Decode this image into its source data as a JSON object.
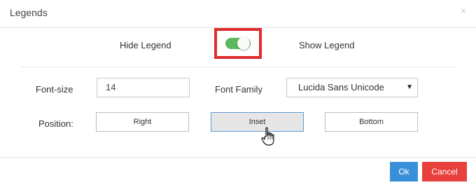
{
  "dialog": {
    "title": "Legends",
    "close_symbol": "×"
  },
  "legend_toggle": {
    "hide_label": "Hide Legend",
    "show_label": "Show Legend",
    "state": "on",
    "on_color": "#5cb85c"
  },
  "font": {
    "size_label": "Font-size",
    "size_value": "14",
    "family_label": "Font Family",
    "family_value": "Lucida Sans Unicode",
    "family_arrow": "▼"
  },
  "position": {
    "label": "Position:",
    "options": [
      "Right",
      "Inset",
      "Bottom"
    ],
    "selected": "Inset"
  },
  "footer": {
    "ok_label": "Ok",
    "cancel_label": "Cancel",
    "ok_color": "#3a8fd9",
    "cancel_color": "#e8403d"
  },
  "highlight_color": "#e02b2b",
  "cursor_icon": "hand-pointer-icon"
}
